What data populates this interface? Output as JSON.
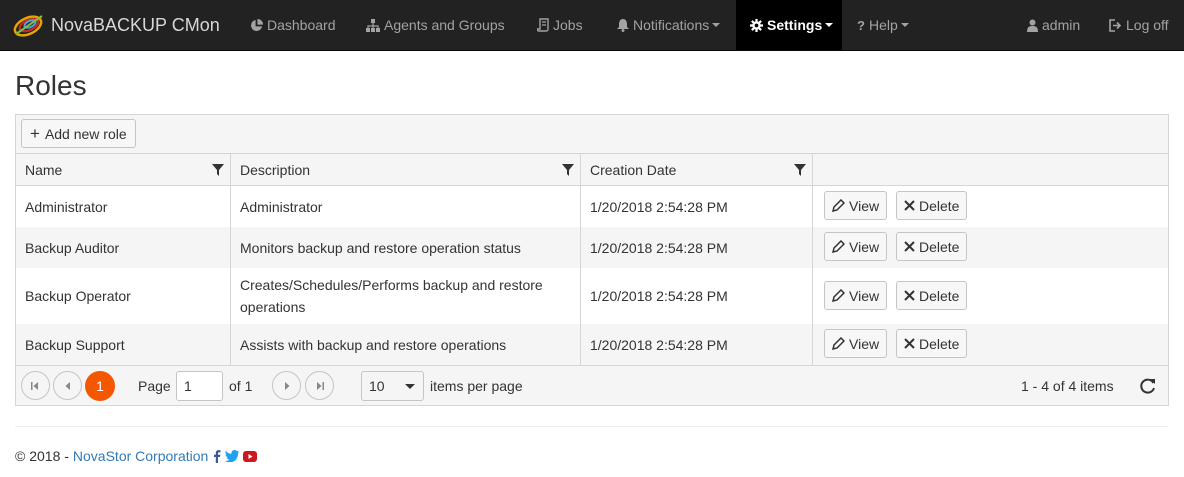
{
  "navbar": {
    "brand": "NovaBACKUP CMon",
    "items": [
      {
        "label": "Dashboard"
      },
      {
        "label": "Agents and Groups"
      },
      {
        "label": "Jobs"
      },
      {
        "label": "Notifications"
      },
      {
        "label": "Settings"
      },
      {
        "label": "Help"
      }
    ],
    "user": "admin",
    "logoff": "Log off"
  },
  "page": {
    "title": "Roles"
  },
  "toolbar": {
    "add_label": "Add new role"
  },
  "table": {
    "columns": [
      "Name",
      "Description",
      "Creation Date",
      ""
    ],
    "rows": [
      {
        "name": "Administrator",
        "description": "Administrator",
        "created": "1/20/2018 2:54:28 PM"
      },
      {
        "name": "Backup Auditor",
        "description": "Monitors backup and restore operation status",
        "created": "1/20/2018 2:54:28 PM"
      },
      {
        "name": "Backup Operator",
        "description": "Creates/Schedules/Performs backup and restore operations",
        "created": "1/20/2018 2:54:28 PM"
      },
      {
        "name": "Backup Support",
        "description": "Assists with backup and restore operations",
        "created": "1/20/2018 2:54:28 PM"
      }
    ],
    "view_label": "View",
    "delete_label": "Delete"
  },
  "pager": {
    "current_page": "1",
    "page_label": "Page",
    "page_input": "1",
    "of_label": "of 1",
    "page_size": "10",
    "per_page_label": "items per page",
    "summary": "1 - 4 of 4 items"
  },
  "footer": {
    "copyright": "© 2018 -",
    "company": "NovaStor Corporation"
  },
  "colors": {
    "navbar": "#222222",
    "active": "#000000",
    "accent": "#f35800",
    "link": "#337ab7",
    "twitter": "#1da1f2",
    "youtube": "#cc181e"
  }
}
